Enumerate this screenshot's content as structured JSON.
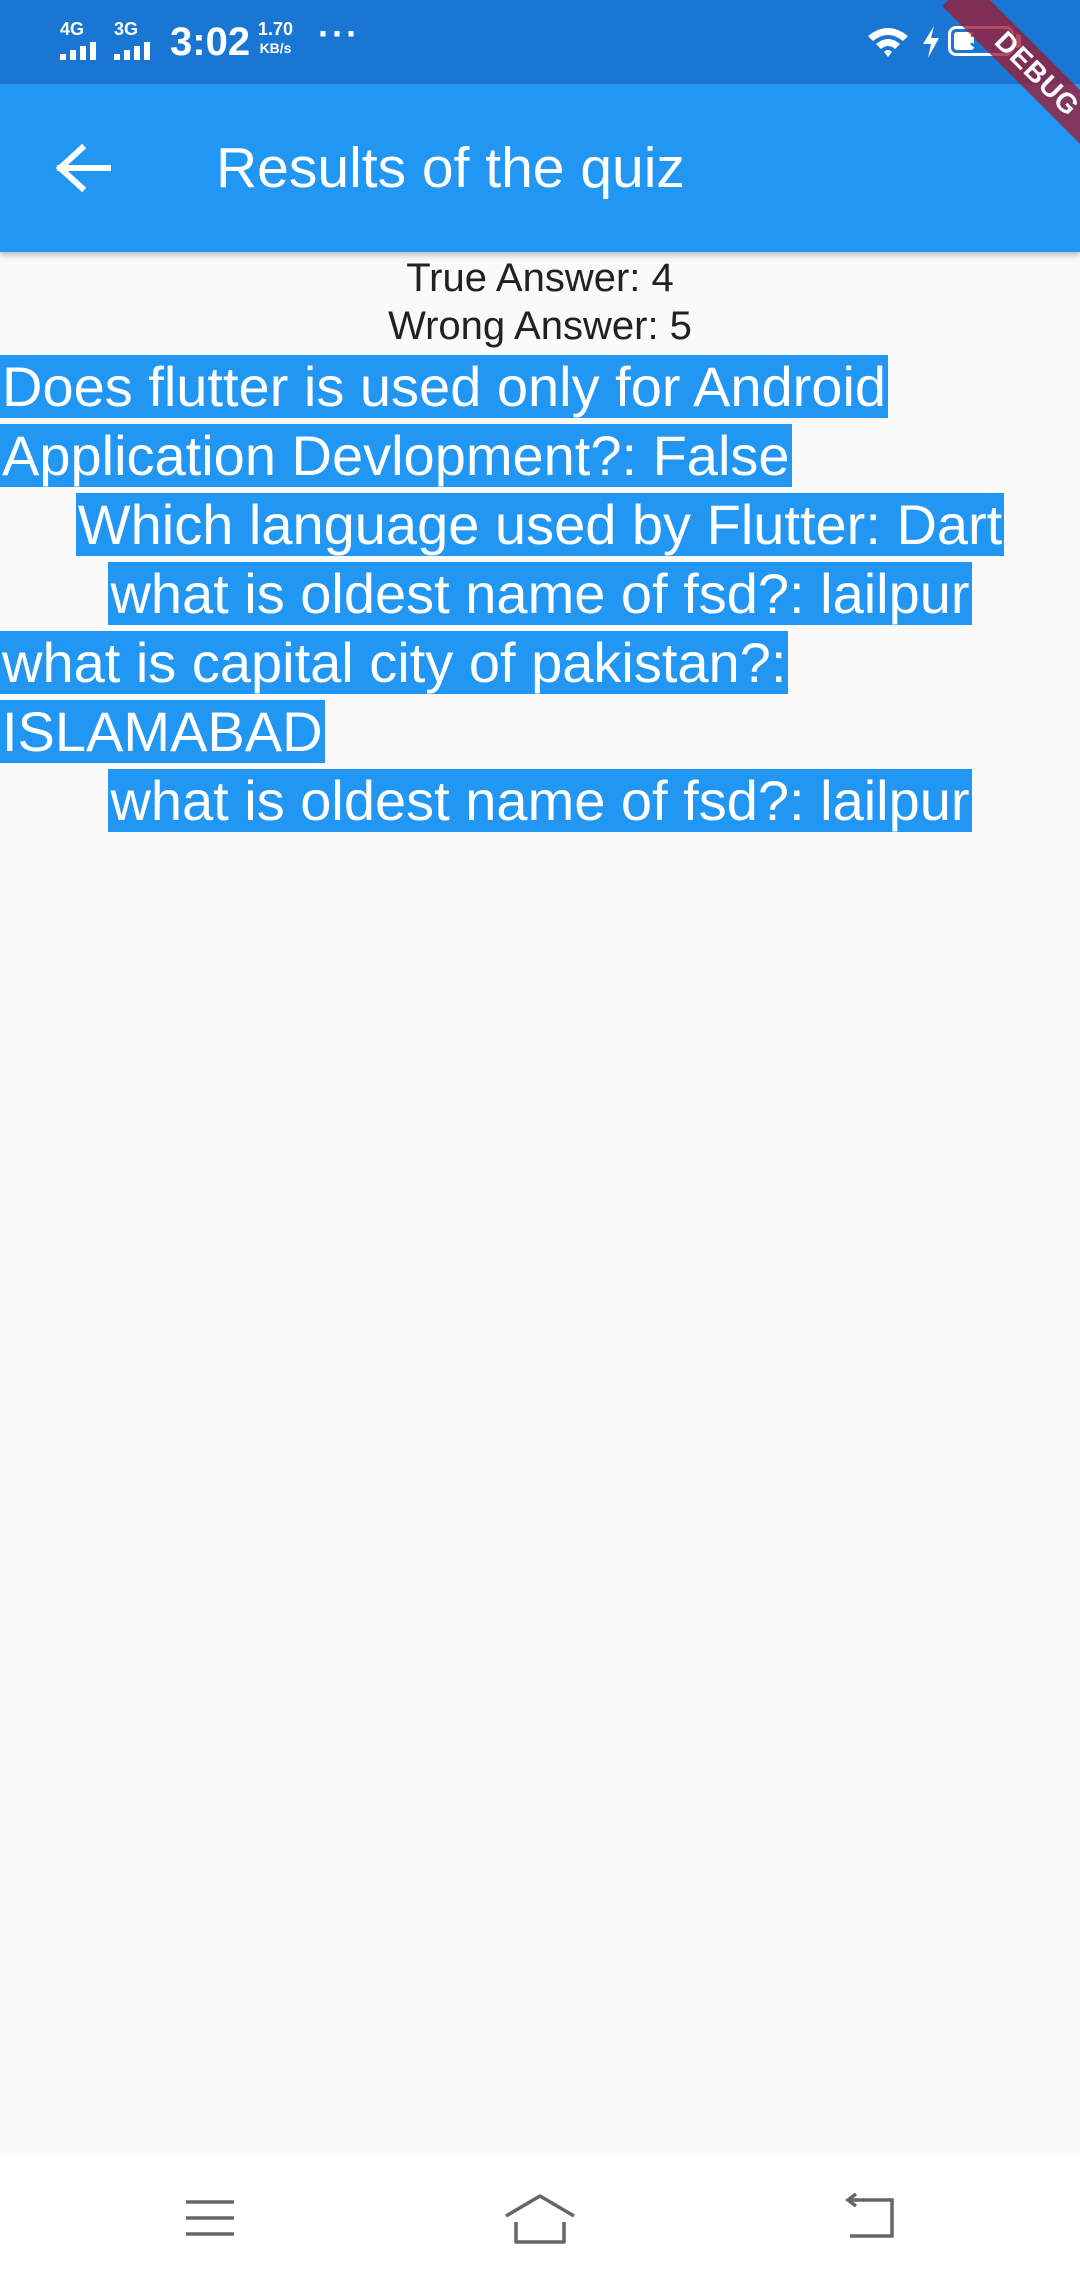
{
  "status_bar": {
    "network_1": "4G",
    "network_2": "3G",
    "time": "3:02",
    "speed_value": "1.70",
    "speed_unit": "KB/s",
    "more": "···",
    "battery_level": "37",
    "battery_fraction": 0.37
  },
  "app_bar": {
    "title": "Results of the quiz",
    "back_icon": "arrow-left-icon",
    "color": "#2196f3"
  },
  "debug_banner": "DEBUG",
  "summary": {
    "true_answer": "True Answer: 4",
    "wrong_answer": "Wrong Answer: 5"
  },
  "answers": [
    {
      "line_1": "Does flutter is used only for Android",
      "line_2": "Application Devlopment?: False"
    },
    {
      "line_1": "Which language used by Flutter: Dart"
    },
    {
      "line_1": "what is oldest name of fsd?: lailpur"
    },
    {
      "line_1": "what is capital city of pakistan?:",
      "line_2": "ISLAMABAD"
    },
    {
      "line_1": "what is oldest name of fsd?: lailpur"
    }
  ],
  "nav_bar": {
    "menu_icon": "menu-icon",
    "home_icon": "home-icon",
    "back_icon": "back-icon"
  },
  "colors": {
    "status_bar": "#1976d2",
    "app_bar": "#2196f3",
    "highlight": "#2196f3",
    "background": "#fafafa"
  }
}
